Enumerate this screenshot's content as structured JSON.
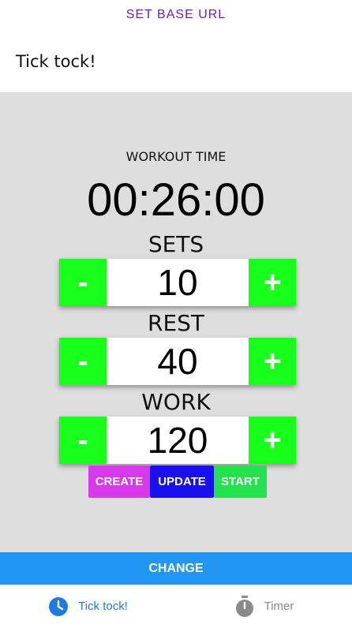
{
  "header": {
    "link_label": "SET BASE URL",
    "title": "Tick tock!"
  },
  "workout": {
    "label": "WORKOUT TIME",
    "time": "00:26:00"
  },
  "steppers": {
    "sets": {
      "label": "SETS",
      "value": "10",
      "minus": "-",
      "plus": "+"
    },
    "rest": {
      "label": "REST",
      "value": "40",
      "minus": "-",
      "plus": "+"
    },
    "work": {
      "label": "WORK",
      "value": "120",
      "minus": "-",
      "plus": "+"
    }
  },
  "actions": {
    "create": "CREATE",
    "update": "UPDATE",
    "start": "START"
  },
  "change_label": "CHANGE",
  "tabs": [
    {
      "label": "Tick tock!",
      "icon": "clock-icon",
      "active": true
    },
    {
      "label": "Timer",
      "icon": "stopwatch-icon",
      "active": false
    }
  ],
  "colors": {
    "accent_link": "#6a1bd0",
    "stepper_green": "#18ff1c",
    "create": "#d63ae8",
    "update": "#1a10ee",
    "start": "#24e24e",
    "change_bar": "#2196f3",
    "tab_active": "#1e7be0",
    "background": "#dedede"
  }
}
